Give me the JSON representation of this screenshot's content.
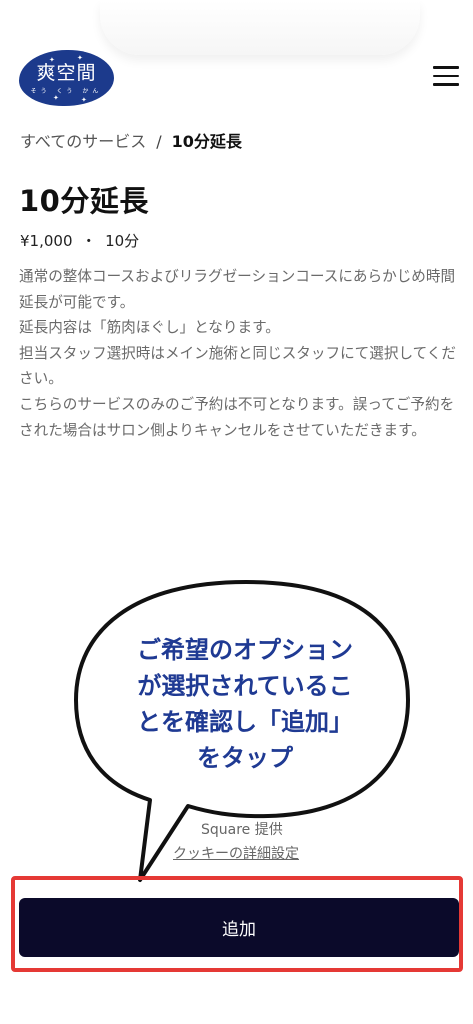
{
  "header": {
    "logo_text": "爽空間",
    "logo_sub": "そう くう かん",
    "menu_icon": "hamburger-menu-icon"
  },
  "breadcrumb": {
    "parent": "すべてのサービス",
    "separator": "/",
    "current": "10分延長"
  },
  "service": {
    "title": "10分延長",
    "price": "¥1,000",
    "dot": "・",
    "duration": "10分",
    "description": [
      "通常の整体コースおよびリラグゼーションコースにあらかじめ時間延長が可能です。",
      "延長内容は「筋肉ほぐし」となります。",
      "担当スタッフ選択時はメイン施術と同じスタッフにて選択してください。",
      "こちらのサービスのみのご予約は不可となります。誤ってご予約をされた場合はサロン側よりキャンセルをさせていただきます。"
    ]
  },
  "annotation": {
    "lines": [
      "ご希望のオプション",
      "が選択されているこ",
      "とを確認し「追加」",
      "をタップ"
    ],
    "text_color": "#1f3a93",
    "highlight_color": "#e53935"
  },
  "footer": {
    "provided_by": "Square 提供",
    "cookie_link": "クッキーの詳細設定"
  },
  "actions": {
    "add_label": "追加"
  }
}
